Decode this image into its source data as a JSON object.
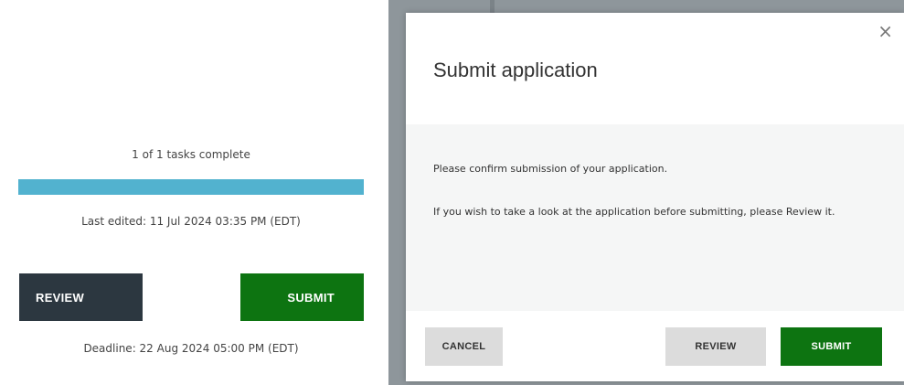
{
  "status_panel": {
    "tasks_summary": "1 of 1 tasks complete",
    "progress_fraction": 1.0,
    "last_edited": "Last edited: 11 Jul 2024 03:35 PM (EDT)",
    "review_label": "REVIEW",
    "submit_label": "SUBMIT",
    "deadline": "Deadline: 22 Aug 2024 05:00 PM (EDT)"
  },
  "modal": {
    "close_glyph": "×",
    "title": "Submit application",
    "confirm_text": "Please confirm submission of your application.",
    "review_note": "If you wish to take a look at the application before submitting, please Review it.",
    "cancel_label": "CANCEL",
    "review_label": "REVIEW",
    "submit_label": "SUBMIT"
  },
  "colors": {
    "progress": "#52b2cf",
    "submit_green": "#0d7411",
    "review_dark": "#2c3740"
  }
}
